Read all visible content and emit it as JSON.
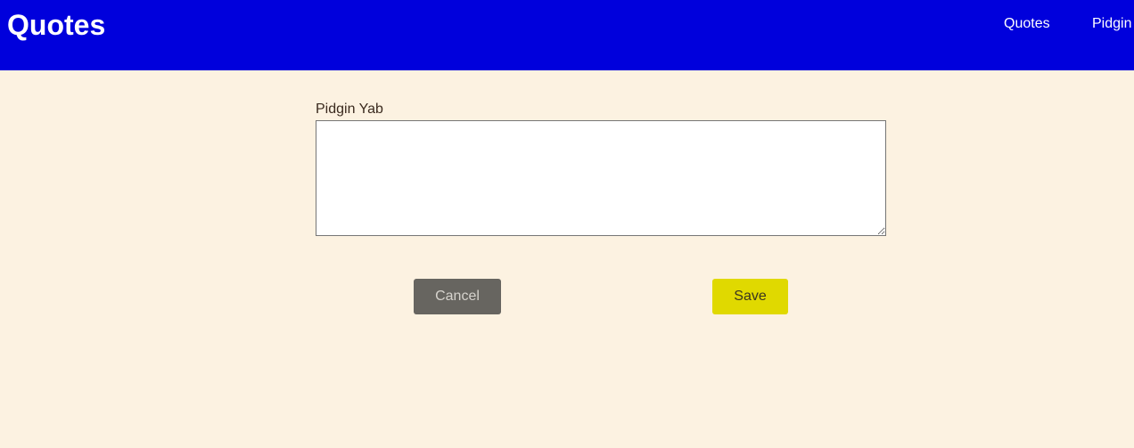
{
  "header": {
    "title": "Quotes",
    "nav": [
      {
        "label": "Quotes"
      },
      {
        "label": "Pidgin"
      }
    ]
  },
  "form": {
    "field_label": "Pidgin Yab",
    "field_value": "",
    "cancel_label": "Cancel",
    "save_label": "Save"
  },
  "colors": {
    "header_bg": "#0000dc",
    "page_bg": "#fcf2e1",
    "cancel_bg": "#676560",
    "save_bg": "#e0d900"
  }
}
